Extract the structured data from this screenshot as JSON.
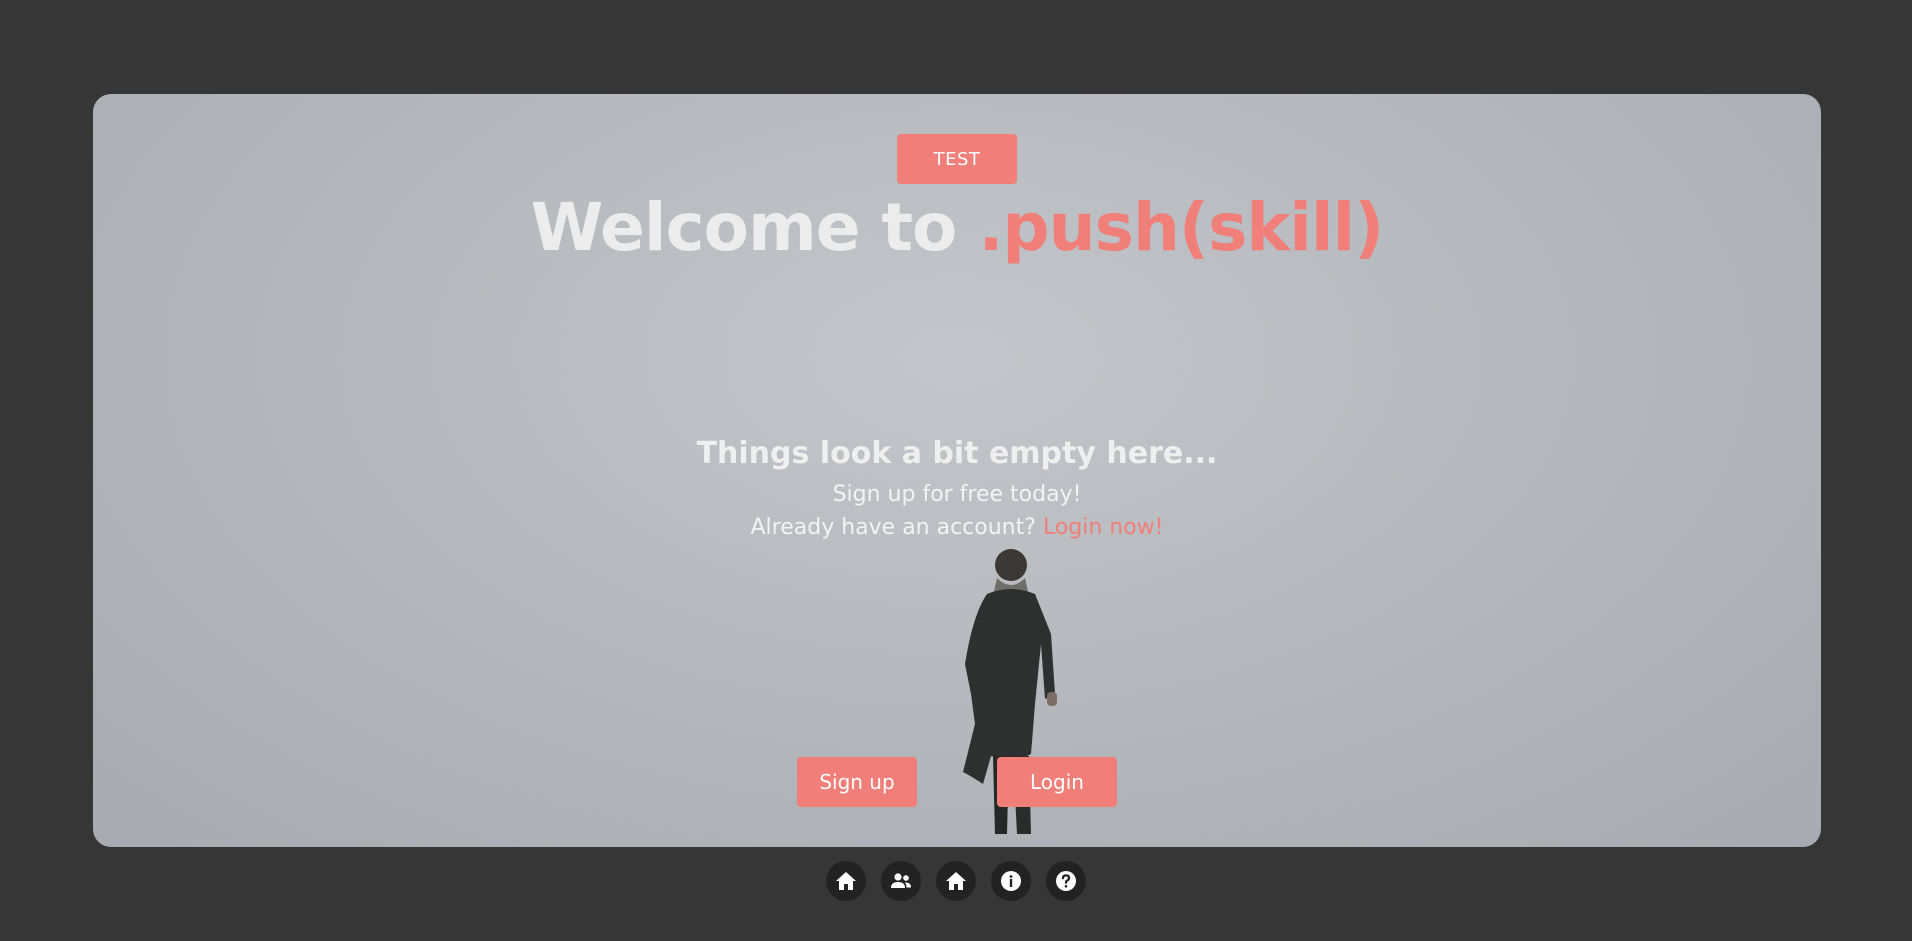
{
  "hero": {
    "test_label": "TEST",
    "welcome_prefix": "Welcome to ",
    "brand": ".push(skill)"
  },
  "empty_state": {
    "title": "Things look a bit empty here...",
    "subtitle": "Sign up for free today!",
    "account_prompt": "Already have an account? ",
    "login_link": "Login now!"
  },
  "actions": {
    "signup_label": "Sign up",
    "login_label": "Login"
  },
  "bottom_nav": {
    "items": [
      {
        "icon": "home-icon"
      },
      {
        "icon": "users-icon"
      },
      {
        "icon": "home-icon"
      },
      {
        "icon": "info-icon"
      },
      {
        "icon": "help-icon"
      }
    ]
  },
  "colors": {
    "accent": "#f07f7a",
    "page_bg": "#363636",
    "nav_button_bg": "#222222"
  }
}
